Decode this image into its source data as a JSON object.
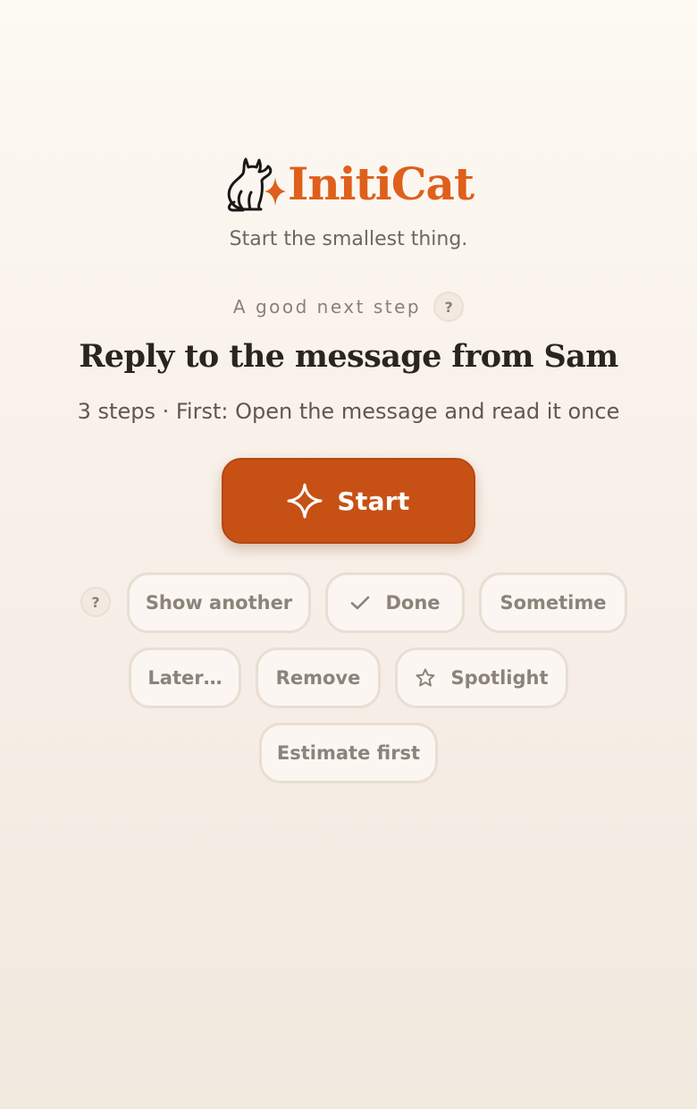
{
  "brand": {
    "logo_icon": "cat-icon",
    "sparkle_icon": "sparkle-icon",
    "name": "InitiCat",
    "tagline": "Start the smallest thing.",
    "accent_color": "#df5f1c"
  },
  "suggestion": {
    "kicker": "A good next step",
    "help_label": "?",
    "title": "Reply to the message from Sam",
    "subtitle": "3 steps · First: Open the message and read it once"
  },
  "primary_action": {
    "label": "Start",
    "icon": "sparkle-icon",
    "color": "#c75114"
  },
  "actions": {
    "help_label": "?",
    "show_another": "Show another",
    "done": "Done",
    "done_icon": "check-icon",
    "sometime": "Sometime",
    "later": "Later…",
    "remove": "Remove",
    "spotlight": "Spotlight",
    "spotlight_icon": "star-icon",
    "estimate_first": "Estimate first"
  }
}
